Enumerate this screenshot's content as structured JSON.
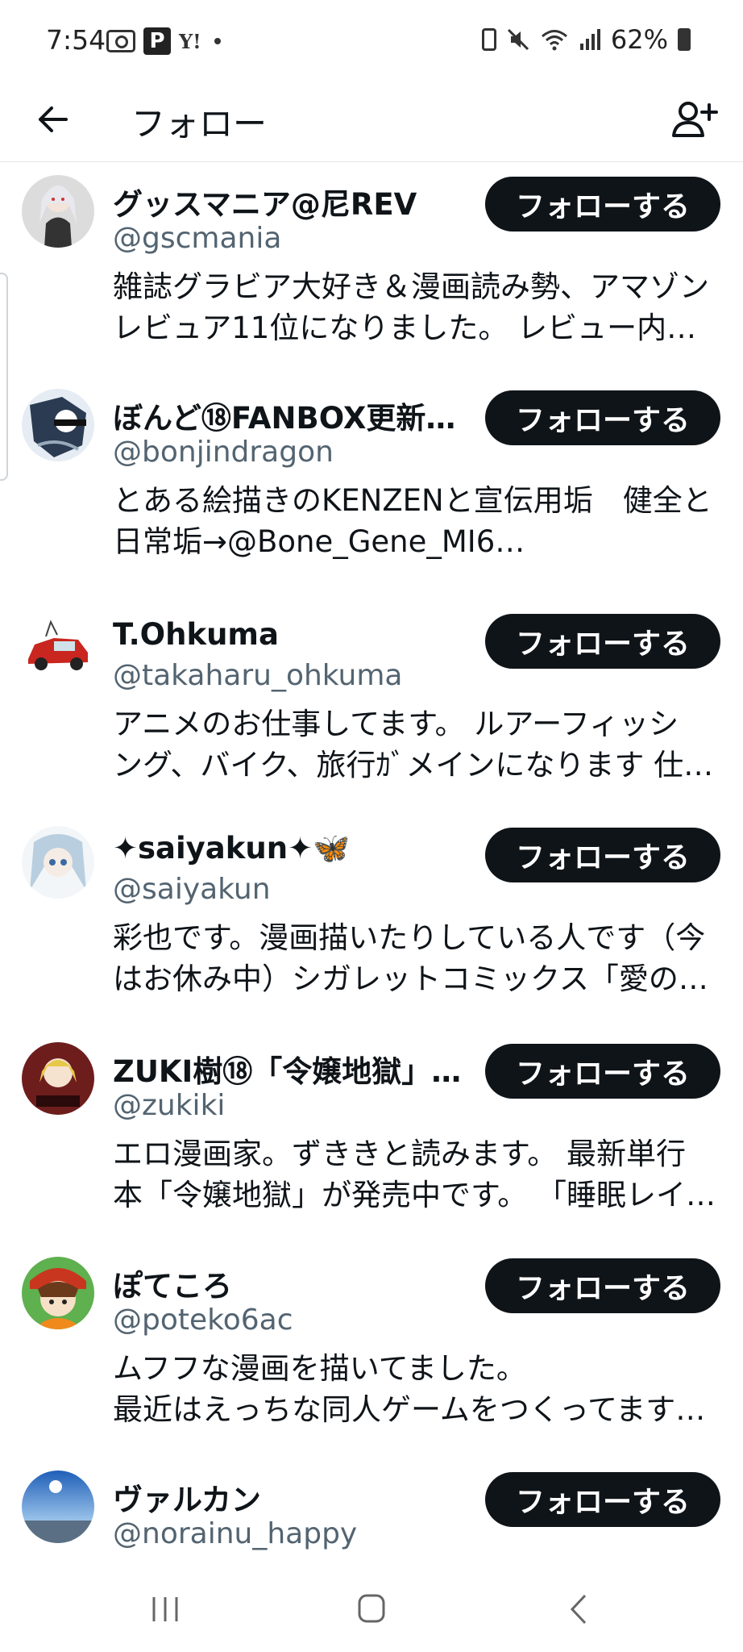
{
  "status_bar": {
    "time": "7:54",
    "battery_percent": "62%",
    "left_icons": [
      "camera-icon",
      "paypay-icon",
      "yahoo-icon",
      "dot-icon"
    ],
    "right_icons": [
      "battery-saver-icon",
      "mute-icon",
      "wifi-icon",
      "signal-icon",
      "battery-icon"
    ],
    "p_glyph": "P",
    "y_glyph": "Y!"
  },
  "header": {
    "title": "フォロー",
    "back_icon": "back-arrow-icon",
    "add_icon": "add-user-icon"
  },
  "follow_label": "フォローする",
  "users": [
    {
      "name": "グッスマニア@尼REV",
      "handle": "@gscmania",
      "bio": [
        "雑誌グラビア大好き＆漫画読み勢、アマゾン",
        "レビュア11位になりました。 レビュー内容…"
      ]
    },
    {
      "name": "ぼんど⑱FANBOX更新…",
      "handle": "@bonjindragon",
      "bio": [
        "とある絵描きのKENZENと宣伝用垢　健全と",
        "日常垢→@Bone_Gene_MI6…"
      ]
    },
    {
      "name": "T.Ohkuma",
      "handle": "@takaharu_ohkuma",
      "bio": [
        "アニメのお仕事してます。 ルアーフィッシ",
        "ング、バイク、旅行ｶﾞメインになります 仕…"
      ]
    },
    {
      "name": "✦saiyakun✦🦋",
      "handle": "@saiyakun",
      "bio": [
        "彩也です。漫画描いたりしている人です（今",
        "はお休み中）シガレットコミックス「愛の…"
      ]
    },
    {
      "name": "ZUKI樹⑱「令嬢地獄」…",
      "handle": "@zukiki",
      "bio": [
        "エロ漫画家。ずききと読みます。 最新単行",
        "本「令嬢地獄」が発売中です。 「睡眠レイ…"
      ]
    },
    {
      "name": "ぽてころ",
      "handle": "@poteko6ac",
      "bio": [
        "ムフフな漫画を描いてました。",
        "最近はえっちな同人ゲームをつくってます…"
      ]
    },
    {
      "name": "ヴァルカン",
      "handle": "@norainu_happy",
      "bio": []
    }
  ],
  "nav_bar": {
    "recents_icon": "recents-icon",
    "home_icon": "home-icon",
    "back_icon": "nav-back-icon"
  }
}
